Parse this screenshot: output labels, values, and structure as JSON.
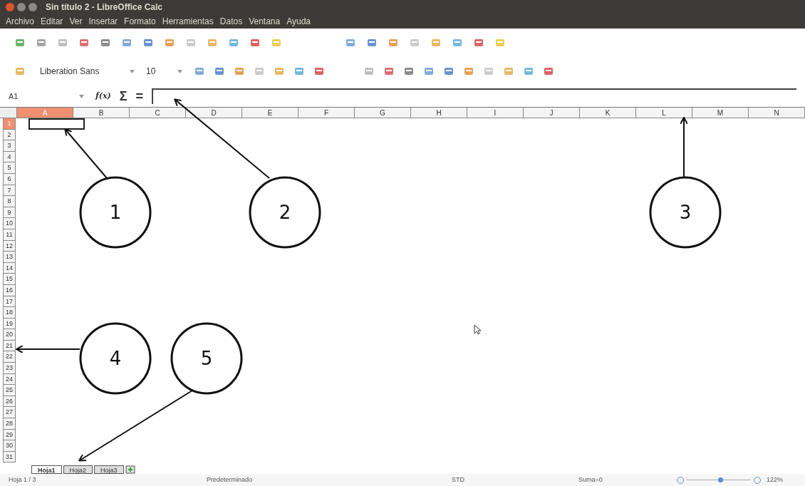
{
  "window": {
    "title": "Sin título 2 - LibreOffice Calc"
  },
  "menu": [
    "Archivo",
    "Editar",
    "Ver",
    "Insertar",
    "Formato",
    "Herramientas",
    "Datos",
    "Ventana",
    "Ayuda"
  ],
  "format_toolbar": {
    "font_name": "Liberation Sans",
    "font_size": "10"
  },
  "formula_bar": {
    "name_box": "A1",
    "function_wizard": "f(x)",
    "sum": "Σ",
    "equals": "="
  },
  "columns": [
    {
      "label": "A",
      "selected": true
    },
    {
      "label": "B",
      "selected": false
    },
    {
      "label": "C",
      "selected": false
    },
    {
      "label": "D",
      "selected": false
    },
    {
      "label": "E",
      "selected": false
    },
    {
      "label": "F",
      "selected": false
    },
    {
      "label": "G",
      "selected": false
    },
    {
      "label": "H",
      "selected": false
    },
    {
      "label": "I",
      "selected": false
    },
    {
      "label": "J",
      "selected": false
    },
    {
      "label": "K",
      "selected": false
    },
    {
      "label": "L",
      "selected": false
    },
    {
      "label": "M",
      "selected": false
    },
    {
      "label": "N",
      "selected": false
    }
  ],
  "rows": [
    {
      "label": "1",
      "selected": true
    },
    {
      "label": "2",
      "selected": false
    },
    {
      "label": "3",
      "selected": false
    },
    {
      "label": "4",
      "selected": false
    },
    {
      "label": "5",
      "selected": false
    },
    {
      "label": "6",
      "selected": false
    },
    {
      "label": "7",
      "selected": false
    },
    {
      "label": "8",
      "selected": false
    },
    {
      "label": "9",
      "selected": false
    },
    {
      "label": "10",
      "selected": false
    },
    {
      "label": "11",
      "selected": false
    },
    {
      "label": "12",
      "selected": false
    },
    {
      "label": "13",
      "selected": false
    },
    {
      "label": "14",
      "selected": false
    },
    {
      "label": "15",
      "selected": false
    },
    {
      "label": "16",
      "selected": false
    },
    {
      "label": "17",
      "selected": false
    },
    {
      "label": "18",
      "selected": false
    },
    {
      "label": "19",
      "selected": false
    },
    {
      "label": "20",
      "selected": false
    },
    {
      "label": "21",
      "selected": false
    },
    {
      "label": "22",
      "selected": false
    },
    {
      "label": "23",
      "selected": false
    },
    {
      "label": "24",
      "selected": false
    },
    {
      "label": "25",
      "selected": false
    },
    {
      "label": "26",
      "selected": false
    },
    {
      "label": "27",
      "selected": false
    },
    {
      "label": "28",
      "selected": false
    },
    {
      "label": "29",
      "selected": false
    },
    {
      "label": "30",
      "selected": false
    },
    {
      "label": "31",
      "selected": false
    }
  ],
  "sheet_tabs": [
    {
      "label": "Hoja1",
      "selected": true
    },
    {
      "label": "Hoja2",
      "selected": false
    },
    {
      "label": "Hoja3",
      "selected": false
    }
  ],
  "status_bar": {
    "sheet": "Hoja 1 / 3",
    "style": "Predeterminado",
    "mode": "STD",
    "sum": "Suma=0",
    "zoom": {
      "level": 0.52,
      "reading": "122%"
    }
  },
  "annotations": [
    "1",
    "2",
    "3",
    "4",
    "5"
  ]
}
